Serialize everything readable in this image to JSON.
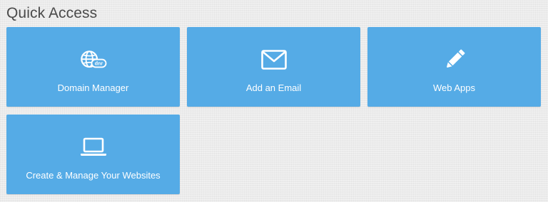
{
  "section": {
    "title": "Quick Access"
  },
  "tiles": [
    {
      "label": "Domain Manager",
      "icon": "globe-dnr-icon",
      "badge": "dnr"
    },
    {
      "label": "Add an Email",
      "icon": "envelope-icon"
    },
    {
      "label": "Web Apps",
      "icon": "pencil-icon"
    },
    {
      "label": "Create & Manage Your Websites",
      "icon": "laptop-icon"
    }
  ],
  "colors": {
    "tile_background": "#55abe6",
    "tile_text": "#ffffff",
    "title_text": "#4a4a4a",
    "page_background": "#ebebeb"
  }
}
